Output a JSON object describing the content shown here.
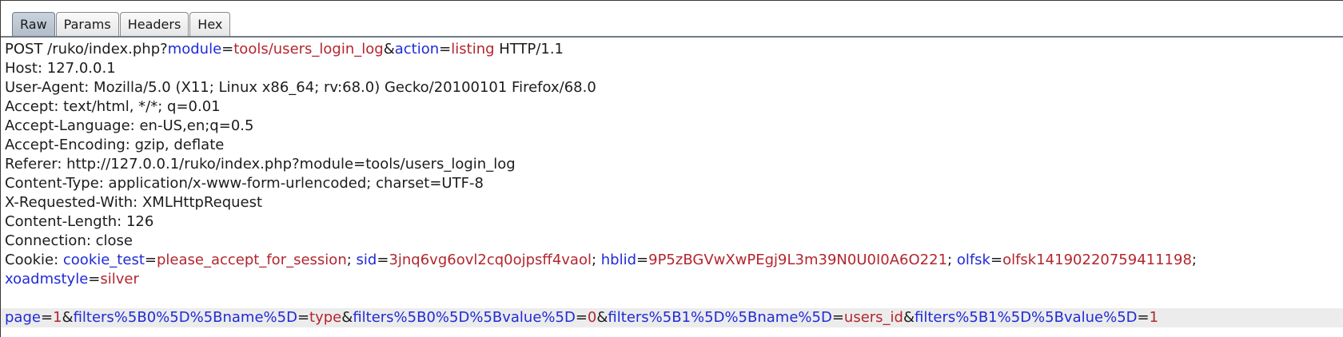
{
  "tabs": [
    {
      "label": "Raw",
      "active": true
    },
    {
      "label": "Params",
      "active": false
    },
    {
      "label": "Headers",
      "active": false
    },
    {
      "label": "Hex",
      "active": false
    }
  ],
  "request": {
    "method_path": "POST /ruko/index.php?",
    "query": [
      {
        "key": "module",
        "value": "tools/users_login_log"
      },
      {
        "key": "action",
        "value": "listing"
      }
    ],
    "protocol": " HTTP/1.1",
    "headers": [
      "Host: 127.0.0.1",
      "User-Agent: Mozilla/5.0 (X11; Linux x86_64; rv:68.0) Gecko/20100101 Firefox/68.0",
      "Accept: text/html, */*; q=0.01",
      "Accept-Language: en-US,en;q=0.5",
      "Accept-Encoding: gzip, deflate",
      "Referer: http://127.0.0.1/ruko/index.php?module=tools/users_login_log",
      "Content-Type: application/x-www-form-urlencoded; charset=UTF-8",
      "X-Requested-With: XMLHttpRequest",
      "Content-Length: 126",
      "Connection: close"
    ],
    "cookie_label": "Cookie: ",
    "cookies": [
      {
        "key": "cookie_test",
        "value": "please_accept_for_session"
      },
      {
        "key": "sid",
        "value": "3jnq6vg6ovl2cq0ojpsff4vaol"
      },
      {
        "key": "hblid",
        "value": "9P5zBGVwXwPEgj9L3m39N0U0I0A6O221"
      },
      {
        "key": "olfsk",
        "value": "olfsk14190220759411198"
      },
      {
        "key": "xoadmstyle",
        "value": "silver"
      }
    ],
    "body": [
      {
        "key": "page",
        "value": "1"
      },
      {
        "key": "filters%5B0%5D%5Bname%5D",
        "value": "type"
      },
      {
        "key": "filters%5B0%5D%5Bvalue%5D",
        "value": "0"
      },
      {
        "key": "filters%5B1%5D%5Bname%5D",
        "value": "users_id"
      },
      {
        "key": "filters%5B1%5D%5Bvalue%5D",
        "value": "1"
      }
    ]
  },
  "colors": {
    "param_name": "#1f2bd8",
    "param_value": "#b3262e",
    "text": "#1c1c1c",
    "active_tab": "#b2bdc9"
  }
}
